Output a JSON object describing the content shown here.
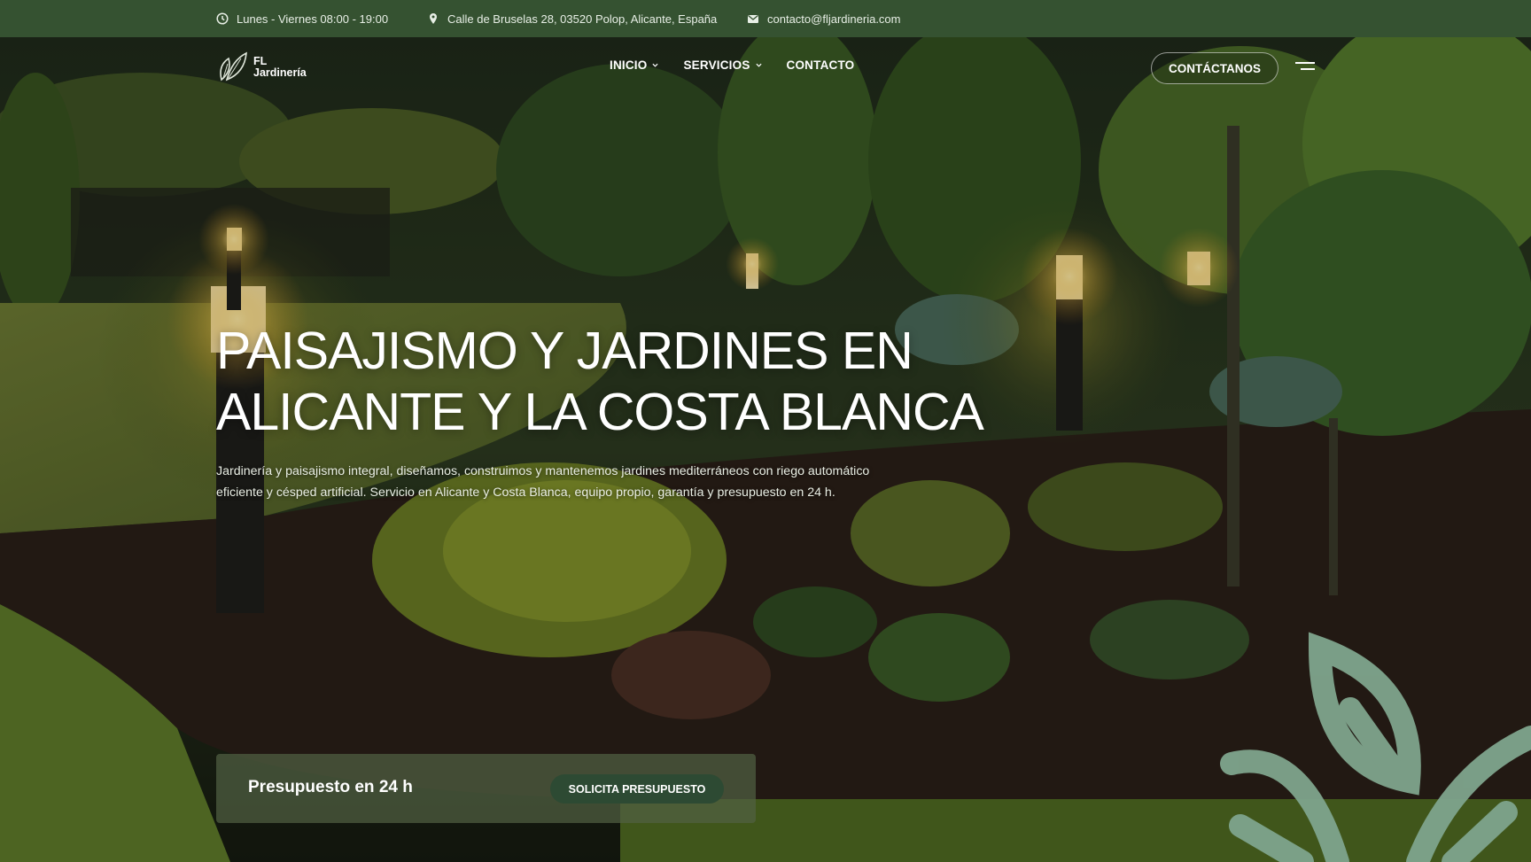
{
  "topbar": {
    "hours": "Lunes - Viernes 08:00 - 19:00",
    "address": "Calle de Bruselas 28, 03520 Polop, Alicante, España",
    "email": "contacto@fljardineria.com",
    "icons": [
      "clock-icon",
      "map-pin-icon",
      "mail-icon"
    ]
  },
  "header": {
    "logo": {
      "line1": "FL",
      "line2": "Jardinería"
    },
    "nav": [
      {
        "label": "INICIO",
        "has_dropdown": true
      },
      {
        "label": "SERVICIOS",
        "has_dropdown": true
      },
      {
        "label": "CONTACTO",
        "has_dropdown": false
      }
    ],
    "cta_label": "CONTÁCTANOS",
    "menu_icon": "hamburger-icon"
  },
  "hero": {
    "headline_line1": "PAISAJISMO Y JARDINES EN",
    "headline_line2": "ALICANTE Y LA COSTA BLANCA",
    "subtitle_line1": "Jardinería y paisajismo integral, diseñamos, construimos y mantenemos jardines mediterráneos con riego automático",
    "subtitle_line2": "eficiente y césped artificial. Servicio en Alicante y Costa Blanca, equipo propio, garantía y presupuesto en 24 h."
  },
  "quote_card": {
    "title": "Presupuesto en 24 h",
    "button_label": "SOLICITA PRESUPUESTO"
  },
  "colors": {
    "topbar_bg": "#355231",
    "button_dark_green": "#2d4a33",
    "leaf_decor": "#7fa58d"
  }
}
